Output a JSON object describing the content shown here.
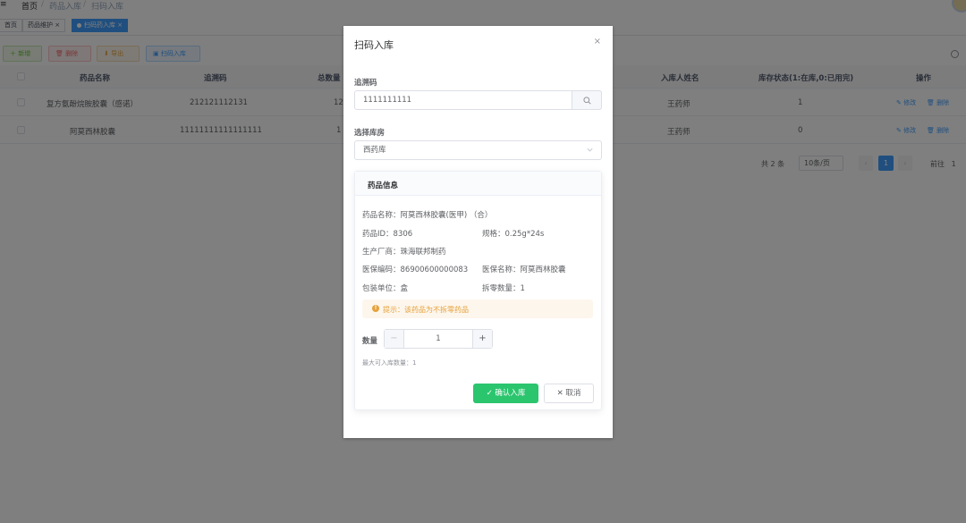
{
  "topbar": {
    "hamburger": "≡",
    "breadcrumb": [
      "首页",
      "/",
      "药品入库",
      "/",
      "扫码入库"
    ]
  },
  "tags": {
    "home": "首页",
    "drug_maintain": "药品维护",
    "scan_in": "扫码药入库"
  },
  "toolbar": {
    "add": "新增",
    "delete": "删除",
    "export": "导出",
    "scan_in": "扫码入库"
  },
  "table": {
    "headers": [
      "药品名称",
      "追溯码",
      "总数量",
      "入库人姓名",
      "库存状态(1:在库,0:已用完)",
      "操作"
    ],
    "rows": [
      {
        "name": "复方氨酚烷胺胶囊（感诺）",
        "trace": "212121112131",
        "qty": "12",
        "person": "王药师",
        "status": "1"
      },
      {
        "name": "阿莫西林胶囊",
        "trace": "11111111111111111",
        "qty": "1",
        "person": "王药师",
        "status": "0"
      }
    ],
    "edit_label": "修改",
    "delete_label": "删除"
  },
  "pager": {
    "total": "共 2 条",
    "size": "10条/页",
    "prev": "‹",
    "page": "1",
    "next": "›",
    "goto": "前往",
    "goto_page": "1"
  },
  "dialog": {
    "title": "扫码入库",
    "close": "×",
    "trace_label": "追溯码",
    "trace_value": "1111111111",
    "warehouse_label": "选择库房",
    "warehouse_value": "西药库",
    "card_title": "药品信息",
    "info": {
      "name": "药品名称：阿莫西林胶囊(医甲) （合）",
      "id": "药品ID：8306",
      "spec": "规格：0.25g*24s",
      "maker": "生产厂商：珠海联邦制药",
      "insurance_code": "医保编码：86900600000083",
      "insurance_name": "医保名称：阿莫西林胶囊",
      "pack_unit": "包装单位：盒",
      "split_qty": "拆零数量：1"
    },
    "alert": "提示：该药品为不拆零药品",
    "quantity_label": "数量",
    "quantity_minus": "−",
    "quantity_value": "1",
    "quantity_plus": "+",
    "max_tip": "最大可入库数量：1",
    "confirm": "确认入库",
    "cancel": "取消"
  }
}
